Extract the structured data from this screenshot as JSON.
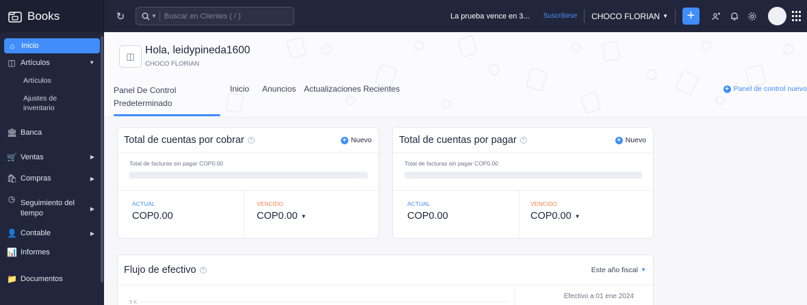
{
  "app": {
    "name": "Books",
    "search_placeholder": "Buscar en Clientes ( / )",
    "trial_text": "La prueba vence en 3...",
    "subscribe_label": "Suscribirse",
    "org_name": "CHOCO FLORIAN",
    "accent": "#408dfb",
    "dark": "#21263c"
  },
  "sidebar": {
    "inicio": "Inicio",
    "articulos": "Artículos",
    "articulos_sub": "Artículos",
    "ajustes": "Ajustes de inventario",
    "banca": "Banca",
    "ventas": "Ventas",
    "compras": "Compras",
    "seguimiento": "Seguimiento del tiempo",
    "contable": "Contable",
    "informes": "Informes",
    "documentos": "Documentos"
  },
  "dashboard": {
    "greeting": "Hola, leidypineda1600",
    "org": "CHOCO FLORIAN",
    "tabs": {
      "panel": "Panel De Control Predeterminado",
      "inicio": "Inicio",
      "anuncios": "Anuncios",
      "actualizaciones": "Actualizaciones Recientes"
    },
    "new_dashboard": "Panel de control nuevo"
  },
  "receivables": {
    "title": "Total de cuentas por cobrar",
    "new_label": "Nuevo",
    "unpaid_text": "Total de facturas sin pagar COP0.00",
    "progress": 0,
    "actual_label": "ACTUAL",
    "actual_value": "COP0.00",
    "overdue_label": "VENCIDO",
    "overdue_value": "COP0.00"
  },
  "payables": {
    "title": "Total de cuentas por pagar",
    "new_label": "Nuevo",
    "unpaid_text": "Total de facturas sin pagar COP0.00",
    "progress": 0,
    "actual_label": "ACTUAL",
    "actual_value": "COP0.00",
    "overdue_label": "VENCIDO",
    "overdue_value": "COP0.00"
  },
  "cashflow": {
    "title": "Flujo de efectivo",
    "period": "Este año fiscal",
    "y_tick": "5 K",
    "note": "Efectivo a 01 ene 2024"
  }
}
